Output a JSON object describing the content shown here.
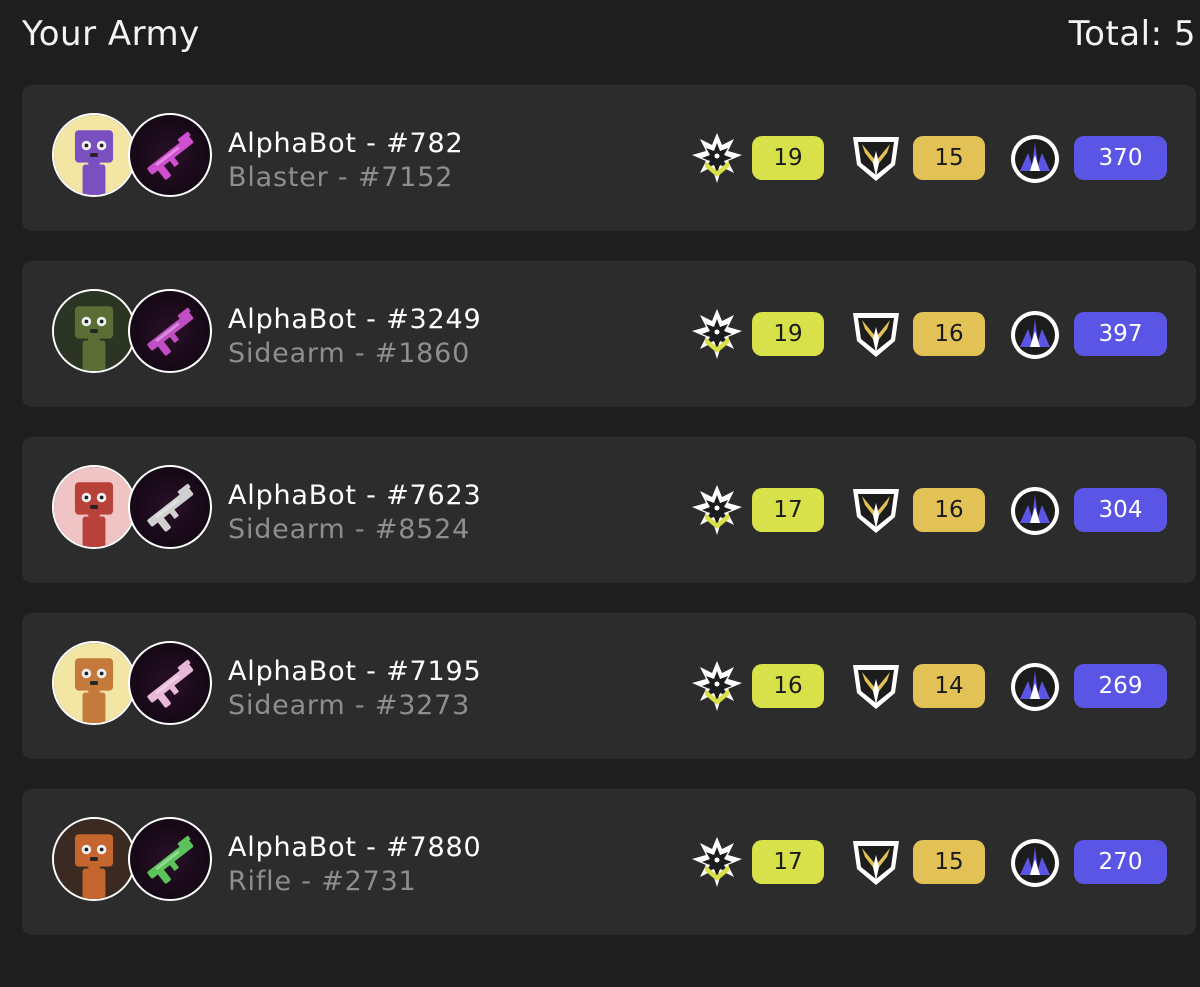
{
  "header": {
    "title": "Your Army",
    "total": "Total: 5"
  },
  "colors": {
    "attack_badge": "#d8e04a",
    "defense_badge": "#e2c257",
    "power_badge": "#5b55e6",
    "card_bg": "#2c2c2c",
    "page_bg": "#1e1e1e"
  },
  "units": [
    {
      "bot_name": "AlphaBot - #782",
      "weapon_name": "Blaster - #7152",
      "bot_bg": "#f3e6a4",
      "bot_color": "#7a4fc0",
      "weapon_color": "#d04fd0",
      "attack": "19",
      "defense": "15",
      "power": "370"
    },
    {
      "bot_name": "AlphaBot - #3249",
      "weapon_name": "Sidearm - #1860",
      "bot_bg": "#2c3524",
      "bot_color": "#5a6e35",
      "weapon_color": "#c04fc4",
      "attack": "19",
      "defense": "16",
      "power": "397"
    },
    {
      "bot_name": "AlphaBot - #7623",
      "weapon_name": "Sidearm - #8524",
      "bot_bg": "#f0c4c4",
      "bot_color": "#b8423a",
      "weapon_color": "#d0d0d0",
      "attack": "17",
      "defense": "16",
      "power": "304"
    },
    {
      "bot_name": "AlphaBot - #7195",
      "weapon_name": "Sidearm - #3273",
      "bot_bg": "#f3e6a4",
      "bot_color": "#c47a3a",
      "weapon_color": "#e8b8d8",
      "attack": "16",
      "defense": "14",
      "power": "269"
    },
    {
      "bot_name": "AlphaBot - #7880",
      "weapon_name": "Rifle - #2731",
      "bot_bg": "#3a2a22",
      "bot_color": "#c4662e",
      "weapon_color": "#5ac45a",
      "attack": "17",
      "defense": "15",
      "power": "270"
    }
  ],
  "icons": {
    "attack": "attack-emblem-icon",
    "defense": "defense-shield-icon",
    "power": "power-crest-icon"
  }
}
